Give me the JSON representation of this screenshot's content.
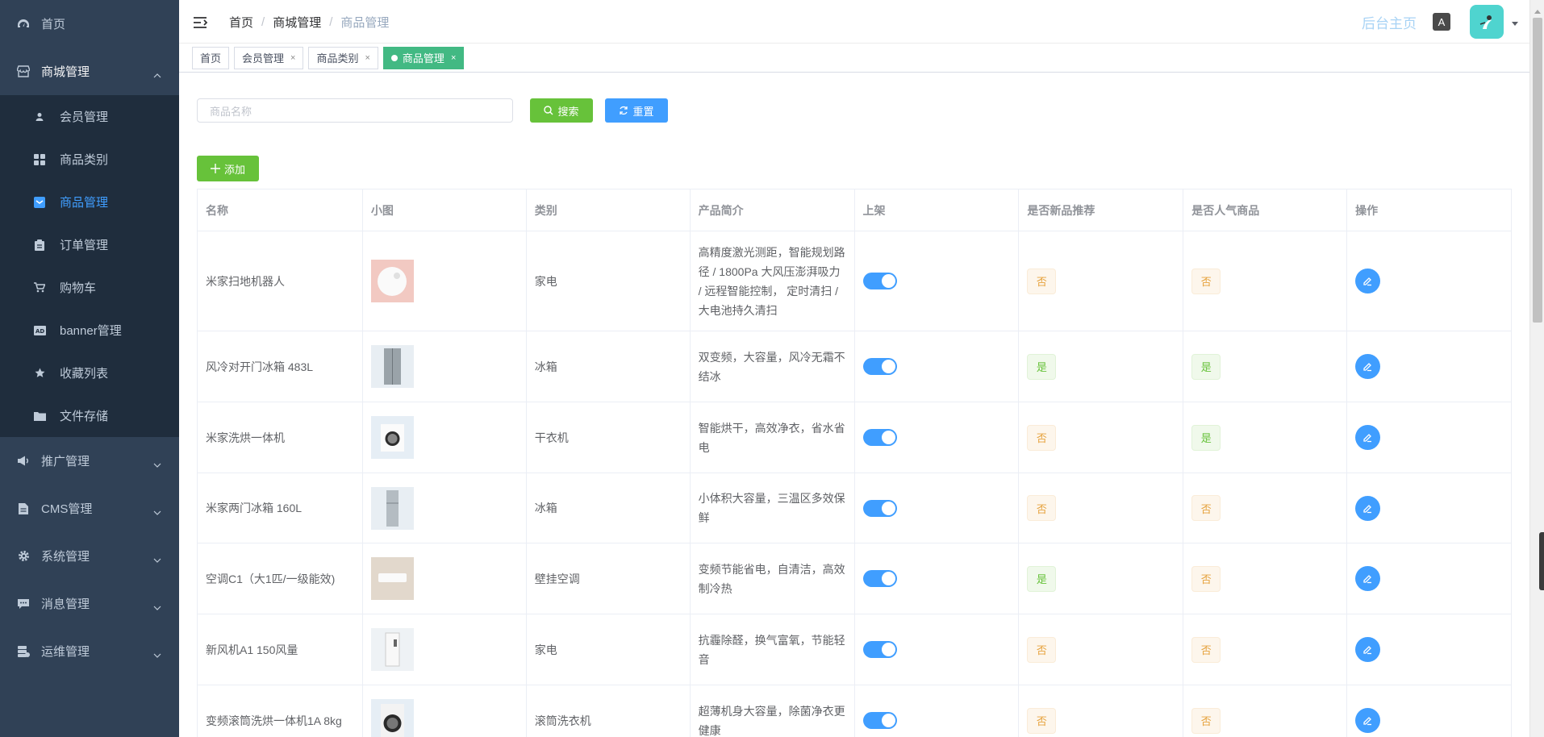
{
  "sidebar": {
    "items": [
      {
        "label": "首页",
        "icon": "dashboard-icon"
      },
      {
        "label": "商城管理",
        "icon": "shop-icon",
        "open": true,
        "children": [
          {
            "label": "会员管理",
            "icon": "user-icon"
          },
          {
            "label": "商品类别",
            "icon": "grid-icon"
          },
          {
            "label": "商品管理",
            "icon": "product-icon",
            "active": true
          },
          {
            "label": "订单管理",
            "icon": "clipboard-icon"
          },
          {
            "label": "购物车",
            "icon": "cart-icon"
          },
          {
            "label": "banner管理",
            "icon": "ad-icon"
          },
          {
            "label": "收藏列表",
            "icon": "star-icon"
          },
          {
            "label": "文件存储",
            "icon": "folder-icon"
          }
        ]
      },
      {
        "label": "推广管理",
        "icon": "megaphone-icon"
      },
      {
        "label": "CMS管理",
        "icon": "document-icon"
      },
      {
        "label": "系统管理",
        "icon": "gear-icon"
      },
      {
        "label": "消息管理",
        "icon": "message-icon"
      },
      {
        "label": "运维管理",
        "icon": "ops-icon"
      }
    ]
  },
  "header": {
    "breadcrumb": [
      "首页",
      "商城管理",
      "商品管理"
    ],
    "home_link": "后台主页",
    "lang_label": "A"
  },
  "tags": [
    {
      "label": "首页",
      "closable": false
    },
    {
      "label": "会员管理",
      "closable": true
    },
    {
      "label": "商品类别",
      "closable": true
    },
    {
      "label": "商品管理",
      "closable": true,
      "active": true
    }
  ],
  "search": {
    "placeholder": "商品名称",
    "search_label": "搜索",
    "reset_label": "重置",
    "add_label": "添加"
  },
  "table": {
    "headers": [
      "名称",
      "小图",
      "类别",
      "产品简介",
      "上架",
      "是否新品推荐",
      "是否人气商品",
      "操作"
    ],
    "rows": [
      {
        "name": "米家扫地机器人",
        "category": "家电",
        "desc": "高精度激光测距，智能规划路径 / 1800Pa 大风压澎湃吸力 / 远程智能控制， 定时清扫 / 大电池持久清扫",
        "on_sale": true,
        "is_new": "否",
        "is_hot": "否",
        "thumb": "robot-vacuum"
      },
      {
        "name": "风冷对开门冰箱 483L",
        "category": "冰箱",
        "desc": "双变频，大容量，风冷无霜不结冰",
        "on_sale": true,
        "is_new": "是",
        "is_hot": "是",
        "thumb": "fridge-double"
      },
      {
        "name": "米家洗烘一体机",
        "category": "干衣机",
        "desc": "智能烘干，高效净衣，省水省电",
        "on_sale": true,
        "is_new": "否",
        "is_hot": "是",
        "thumb": "washer"
      },
      {
        "name": "米家两门冰箱 160L",
        "category": "冰箱",
        "desc": "小体积大容量，三温区多效保鲜",
        "on_sale": true,
        "is_new": "否",
        "is_hot": "否",
        "thumb": "fridge-single"
      },
      {
        "name": "空调C1（大1匹/一级能效)",
        "category": "壁挂空调",
        "desc": "变频节能省电，自清洁，高效制冷热",
        "on_sale": true,
        "is_new": "是",
        "is_hot": "否",
        "thumb": "air-conditioner"
      },
      {
        "name": "新风机A1 150风量",
        "category": "家电",
        "desc": "抗霾除醛，换气富氧，节能轻音",
        "on_sale": true,
        "is_new": "否",
        "is_hot": "否",
        "thumb": "air-purifier"
      },
      {
        "name": "变频滚筒洗烘一体机1A 8kg",
        "category": "滚筒洗衣机",
        "desc": "超薄机身大容量，除菌净衣更健康",
        "on_sale": true,
        "is_new": "否",
        "is_hot": "否",
        "thumb": "drum-washer"
      }
    ]
  },
  "colors": {
    "sidebar_bg": "#304156",
    "submenu_bg": "#1f2d3d",
    "primary": "#409eff",
    "success": "#67c23a",
    "tag_active": "#42b983"
  }
}
